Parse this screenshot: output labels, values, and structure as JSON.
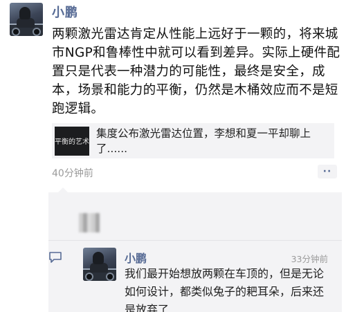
{
  "post": {
    "author": "小鹏",
    "text": "两颗激光雷达肯定从性能上远好于一颗的，将来城市NGP和鲁棒性中就可以看到差异。实际上硬件配置只是代表一种潜力的可能性，最终是安全，成本，场景和能力的平衡，仍然是木桶效应而不是短跑逻辑。",
    "shared_link": {
      "thumbnail_text": "平衡的艺术",
      "title": "集度公布激光雷达位置，李想和夏一平却聊上了......"
    },
    "timestamp": "40分钟前",
    "more_icon": "ellipsis-icon"
  },
  "comments": [
    {
      "author": "小鹏",
      "time": "33分钟前",
      "text": "我们最开始想放两颗在车顶的，但是无论如何设计，都类似兔子的耙耳朵，后来还是放弃了"
    }
  ],
  "colors": {
    "name": "#576b95",
    "secondary": "#9a9a9a",
    "panel": "#f3f3f5"
  }
}
